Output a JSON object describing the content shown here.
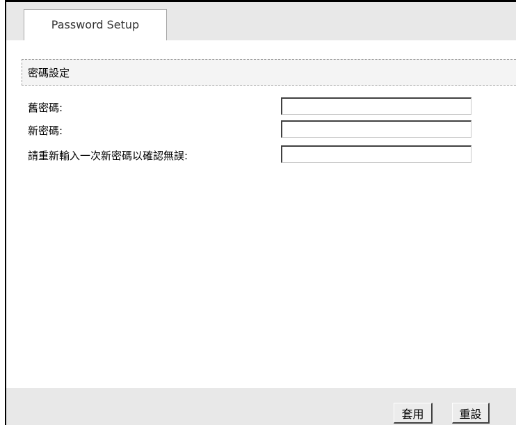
{
  "tabs": [
    {
      "label": "Password Setup",
      "active": true
    }
  ],
  "section": {
    "title": "密碼設定"
  },
  "fields": {
    "old_password": {
      "label": "舊密碼:",
      "value": ""
    },
    "new_password": {
      "label": "新密碼:",
      "value": ""
    },
    "confirm_password": {
      "label": "請重新輸入一次新密碼以確認無誤:",
      "value": ""
    }
  },
  "buttons": {
    "apply_label": "套用",
    "reset_label": "重設"
  }
}
